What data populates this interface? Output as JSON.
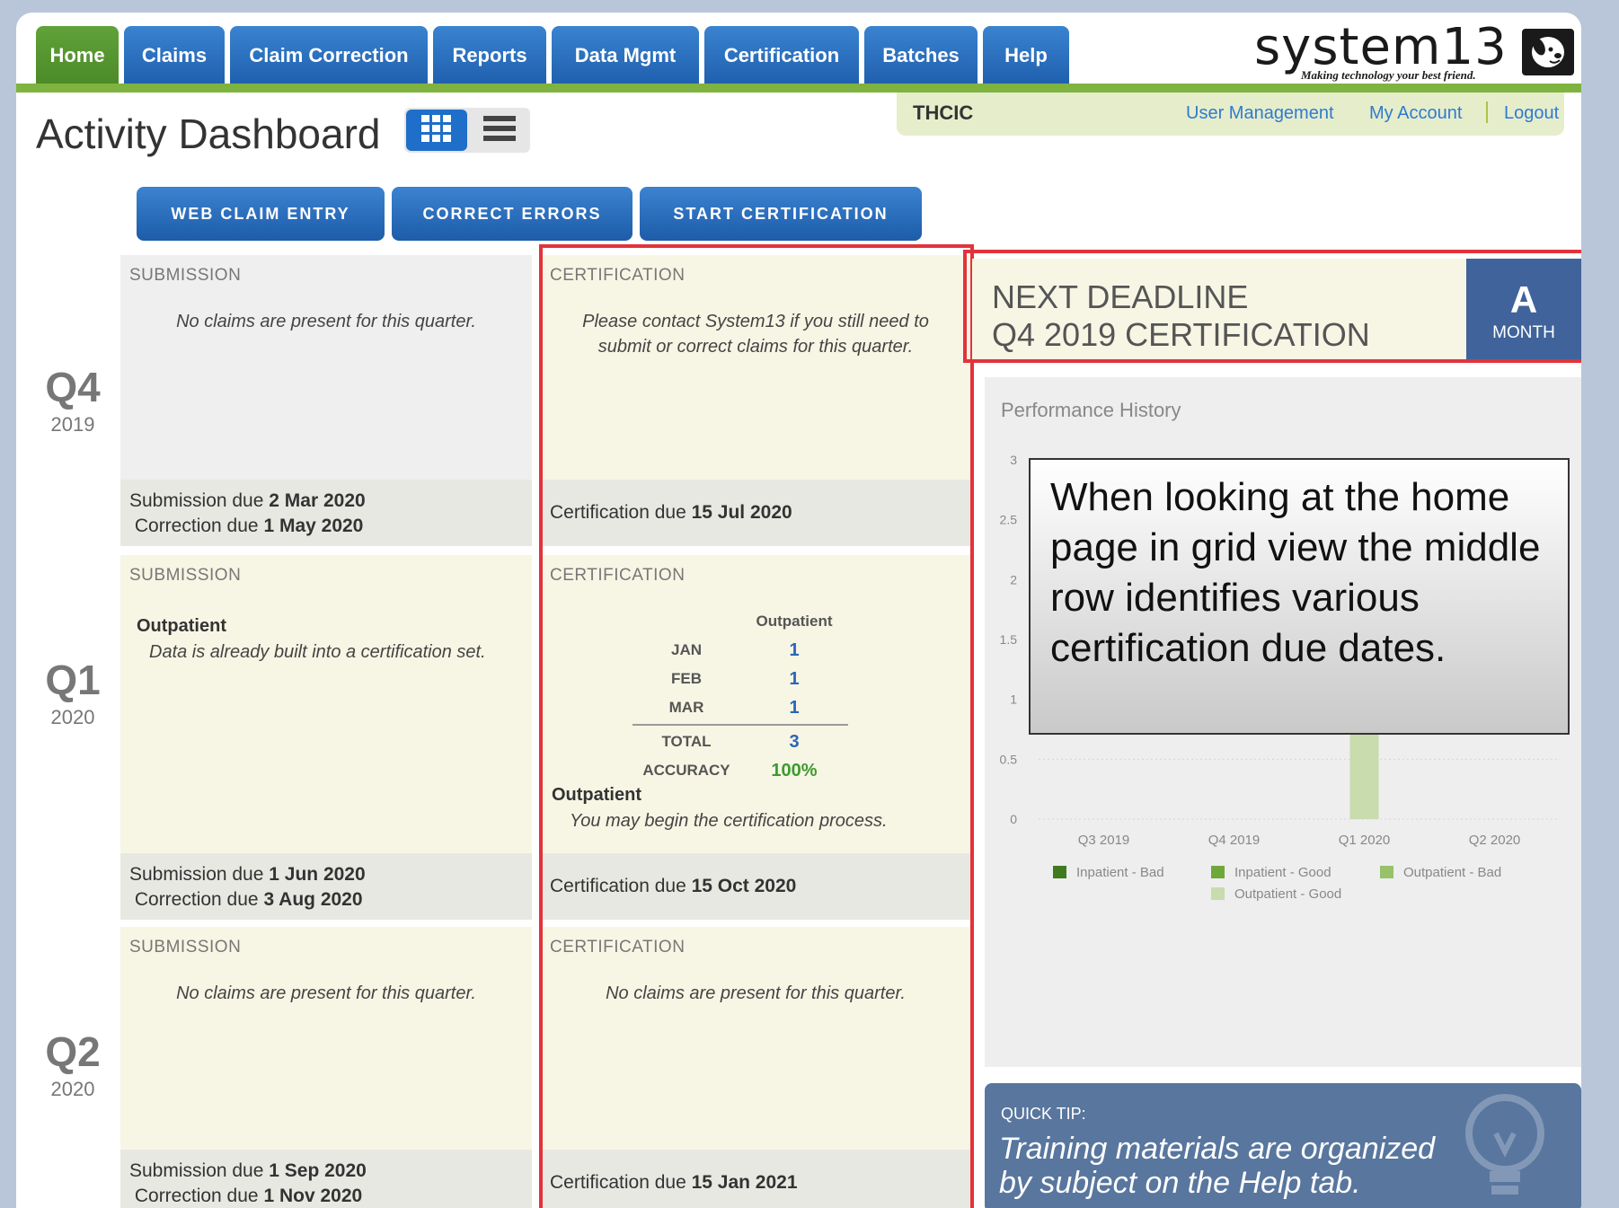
{
  "nav": {
    "tabs": [
      {
        "label": "Home",
        "active": true
      },
      {
        "label": "Claims"
      },
      {
        "label": "Claim Correction"
      },
      {
        "label": "Reports"
      },
      {
        "label": "Data Mgmt"
      },
      {
        "label": "Certification"
      },
      {
        "label": "Batches"
      },
      {
        "label": "Help"
      }
    ]
  },
  "logo": {
    "word": "system13",
    "tagline": "Making technology your best friend.",
    "icon": "dog-icon"
  },
  "account": {
    "org": "THCIC",
    "links": [
      "User Management",
      "My Account",
      "Logout"
    ]
  },
  "page": {
    "title": "Activity Dashboard",
    "views": [
      "grid-view-icon",
      "list-view-icon"
    ]
  },
  "actions": [
    "WEB CLAIM ENTRY",
    "CORRECT ERRORS",
    "START CERTIFICATION"
  ],
  "labels": {
    "submission": "SUBMISSION",
    "certification": "CERTIFICATION",
    "submission_due": "Submission due",
    "correction_due": "Correction due",
    "certification_due": "Certification due"
  },
  "quarters": [
    {
      "name": "Q4",
      "year": "2019",
      "submission_msg": "No claims are present for this quarter.",
      "certification_msg": "Please contact System13 if you still need to submit or correct claims for this quarter.",
      "submission_due": "2 Mar 2020",
      "correction_due": "1 May 2020",
      "certification_due": "15 Jul 2020"
    },
    {
      "name": "Q1",
      "year": "2020",
      "submission_type": "Outpatient",
      "submission_msg": "Data is already built into a certification set.",
      "cert_table": {
        "header": "Outpatient",
        "rows": [
          {
            "k": "JAN",
            "v": "1"
          },
          {
            "k": "FEB",
            "v": "1"
          },
          {
            "k": "MAR",
            "v": "1"
          }
        ],
        "total_label": "TOTAL",
        "total": "3",
        "accuracy_label": "ACCURACY",
        "accuracy": "100%"
      },
      "cert_type": "Outpatient",
      "certification_msg": "You may begin the certification process.",
      "submission_due": "1 Jun 2020",
      "correction_due": "3 Aug 2020",
      "certification_due": "15 Oct 2020"
    },
    {
      "name": "Q2",
      "year": "2020",
      "submission_msg": "No claims are present for this quarter.",
      "certification_msg": "No claims are present for this quarter.",
      "submission_due": "1 Sep 2020",
      "correction_due": "1 Nov 2020",
      "certification_due": "15 Jan 2021"
    }
  ],
  "deadline": {
    "line1": "NEXT DEADLINE",
    "line2": "Q4 2019 CERTIFICATION",
    "badge_letter": "A",
    "badge_unit": "MONTH"
  },
  "performance": {
    "title": "Performance History"
  },
  "chart_data": {
    "type": "bar",
    "title": "Performance History",
    "categories": [
      "Q3 2019",
      "Q4 2019",
      "Q1 2020",
      "Q2 2020"
    ],
    "ylim": [
      0,
      3
    ],
    "yticks": [
      "0",
      "0.5",
      "1",
      "1.5",
      "2",
      "2.5",
      "3"
    ],
    "series": [
      {
        "name": "Inpatient - Bad",
        "color": "#3f7a1f",
        "values": [
          0,
          0,
          0,
          0
        ]
      },
      {
        "name": "Inpatient - Good",
        "color": "#6ea83a",
        "values": [
          0,
          0,
          0,
          0
        ]
      },
      {
        "name": "Outpatient - Bad",
        "color": "#98c26a",
        "values": [
          0,
          0,
          0,
          0
        ]
      },
      {
        "name": "Outpatient - Good",
        "color": "#c8dcae",
        "values": [
          0,
          0,
          3,
          0
        ]
      }
    ],
    "legend": "bottom",
    "grid": true
  },
  "callout": {
    "text": "When looking at the home page in grid view the middle row identifies various certification due dates."
  },
  "tip": {
    "label": "QUICK TIP:",
    "text": "Training materials are organized by subject on the Help tab.",
    "icon": "lightbulb-icon"
  },
  "colors": {
    "nav_blue": "#2a6fc4",
    "nav_green": "#5a9a32",
    "highlight_red": "#e2333a",
    "deadline_badge": "#40639b"
  }
}
